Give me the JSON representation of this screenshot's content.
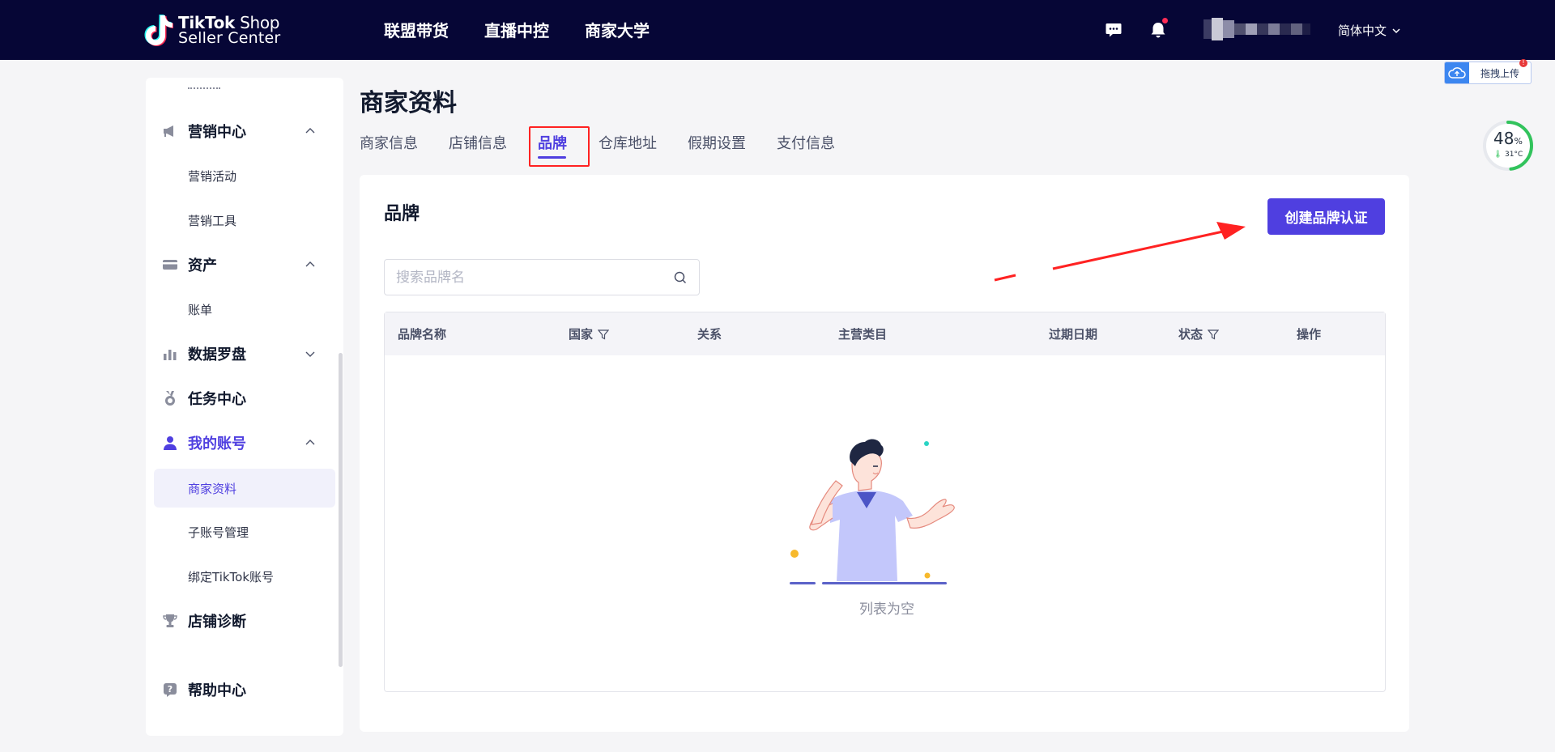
{
  "header": {
    "logo": {
      "line1_bold": "TikTok",
      "line1_rest": " Shop",
      "line2": "Seller Center"
    },
    "nav": [
      "联盟带货",
      "直播中控",
      "商家大学"
    ],
    "language": "简体中文"
  },
  "sidebar": {
    "groups": [
      {
        "label": "营销中心",
        "icon": "megaphone-icon",
        "expanded": true,
        "children": [
          "营销活动",
          "营销工具"
        ]
      },
      {
        "label": "资产",
        "icon": "card-icon",
        "expanded": true,
        "children": [
          "账单"
        ]
      },
      {
        "label": "数据罗盘",
        "icon": "bar-chart-icon",
        "expanded": false,
        "children": []
      },
      {
        "label": "任务中心",
        "icon": "medal-icon",
        "expanded": false,
        "children": []
      },
      {
        "label": "我的账号",
        "icon": "user-icon",
        "expanded": true,
        "active": true,
        "children": [
          "商家资料",
          "子账号管理",
          "绑定TikTok账号"
        ]
      },
      {
        "label": "店铺诊断",
        "icon": "trophy-icon",
        "expanded": false,
        "children": []
      },
      {
        "label": "帮助中心",
        "icon": "help-icon",
        "expanded": false,
        "children": []
      }
    ],
    "active_item": "商家资料"
  },
  "main": {
    "title": "商家资料",
    "tabs": [
      "商家信息",
      "店铺信息",
      "品牌",
      "仓库地址",
      "假期设置",
      "支付信息"
    ],
    "active_tab": "品牌",
    "card": {
      "title": "品牌",
      "create_button": "创建品牌认证",
      "search_placeholder": "搜索品牌名",
      "columns": [
        "品牌名称",
        "国家",
        "关系",
        "主营类目",
        "过期日期",
        "状态",
        "操作"
      ],
      "filterable_columns": [
        "国家",
        "状态"
      ],
      "rows": [],
      "empty_text": "列表为空"
    }
  },
  "widgets": {
    "upload_label": "拖拽上传",
    "upload_badge": "!",
    "perf_percent": "48",
    "perf_percent_unit": "%",
    "perf_temp": "31°C"
  },
  "colors": {
    "header_bg": "#060636",
    "accent": "#4f3fe0",
    "highlight_box": "#ff2222",
    "annotation_arrow": "#ff2222"
  }
}
